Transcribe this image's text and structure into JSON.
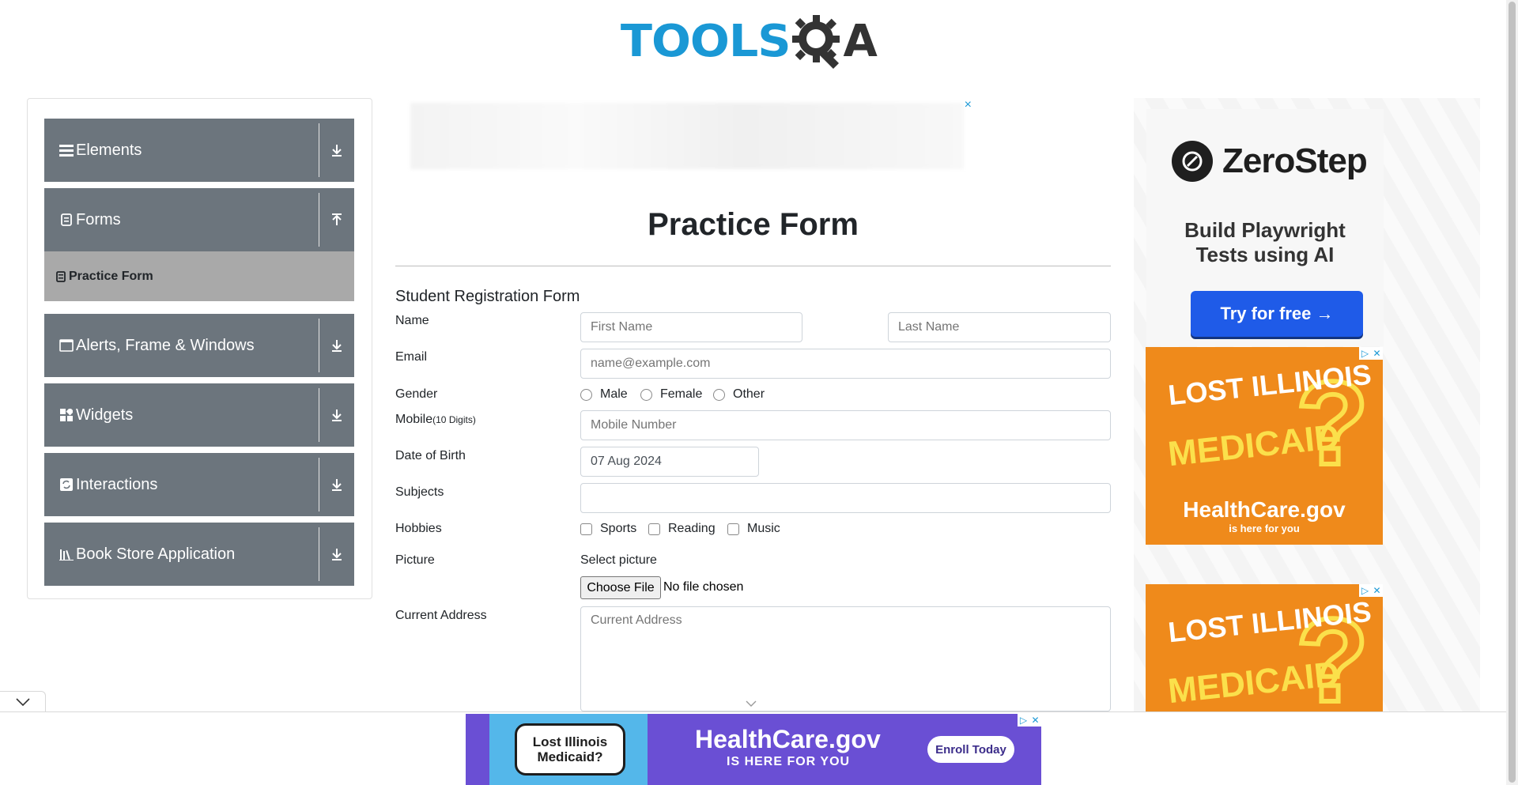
{
  "header": {
    "logo_text_left": "TOOLS",
    "logo_text_right": "A"
  },
  "sidebar": {
    "groups": [
      {
        "label": "Elements",
        "icon": "menu-icon",
        "arrow": "expand"
      },
      {
        "label": "Forms",
        "icon": "document-icon",
        "arrow": "collapse"
      },
      {
        "label": "Alerts, Frame & Windows",
        "icon": "window-icon",
        "arrow": "expand"
      },
      {
        "label": "Widgets",
        "icon": "widgets-icon",
        "arrow": "expand"
      },
      {
        "label": "Interactions",
        "icon": "interactions-icon",
        "arrow": "expand"
      },
      {
        "label": "Book Store Application",
        "icon": "books-icon",
        "arrow": "expand"
      }
    ],
    "active_item": {
      "label": "Practice Form",
      "icon": "form-icon"
    }
  },
  "main": {
    "ad_close": "×",
    "page_title": "Practice Form",
    "form_title": "Student Registration Form",
    "labels": {
      "name": "Name",
      "email": "Email",
      "gender": "Gender",
      "mobile": "Mobile",
      "mobile_hint": "(10 Digits)",
      "dob": "Date of Birth",
      "subjects": "Subjects",
      "hobbies": "Hobbies",
      "picture": "Picture",
      "address": "Current Address"
    },
    "placeholders": {
      "first_name": "First Name",
      "last_name": "Last Name",
      "email": "name@example.com",
      "mobile": "Mobile Number",
      "address": "Current Address"
    },
    "dob_value": "07 Aug 2024",
    "gender_options": [
      "Male",
      "Female",
      "Other"
    ],
    "hobby_options": [
      "Sports",
      "Reading",
      "Music"
    ],
    "picture": {
      "select_label": "Select picture",
      "button": "Choose File",
      "status": "No file chosen"
    }
  },
  "ads": {
    "zerostep": {
      "name": "ZeroStep",
      "tagline": "Build Playwright Tests using AI",
      "button": "Try for free →"
    },
    "medicaid": {
      "line1": "LOST ILLINOIS",
      "line2": "MEDICAID",
      "brand": "HealthCare.gov",
      "sub": "is here for you"
    },
    "banner": {
      "bubble": "Lost Illinois Medicaid?",
      "brand": "HealthCare.gov",
      "sub": "IS HERE FOR YOU",
      "button": "Enroll Today"
    },
    "adchoices": "▷",
    "close": "✕"
  },
  "colors": {
    "brand_blue": "#1a98d5",
    "sidebar_gray": "#6c757d",
    "active_gray": "#a9a9a9",
    "ad_orange": "#ef8a1b",
    "banner_purple": "#6a4fd4"
  }
}
